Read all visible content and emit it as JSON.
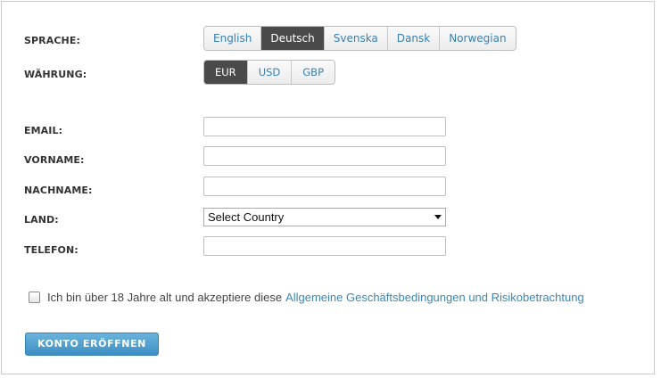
{
  "labels": {
    "language": "SPRACHE:",
    "currency": "WÄHRUNG:",
    "email": "EMAIL:",
    "firstname": "VORNAME:",
    "lastname": "NACHNAME:",
    "country": "LAND:",
    "phone": "TELEFON:"
  },
  "languages": {
    "options": [
      "English",
      "Deutsch",
      "Svenska",
      "Dansk",
      "Norwegian"
    ],
    "selected": "Deutsch"
  },
  "currencies": {
    "options": [
      "EUR",
      "USD",
      "GBP"
    ],
    "selected": "EUR"
  },
  "fields": {
    "email": "",
    "firstname": "",
    "lastname": "",
    "phone": ""
  },
  "country_select": {
    "selected": "Select Country",
    "icon": "chevron-down-icon"
  },
  "agreement": {
    "checked": false,
    "text": "Ich bin über 18 Jahre alt und akzeptiere diese",
    "link": "Allgemeine Geschäftsbedingungen und Risikobetrachtung"
  },
  "submit_label": "KONTO ERÖFFNEN",
  "colors": {
    "active_segment": "#4a4a4a",
    "link": "#3a86b6",
    "button": "#4a9ace"
  }
}
